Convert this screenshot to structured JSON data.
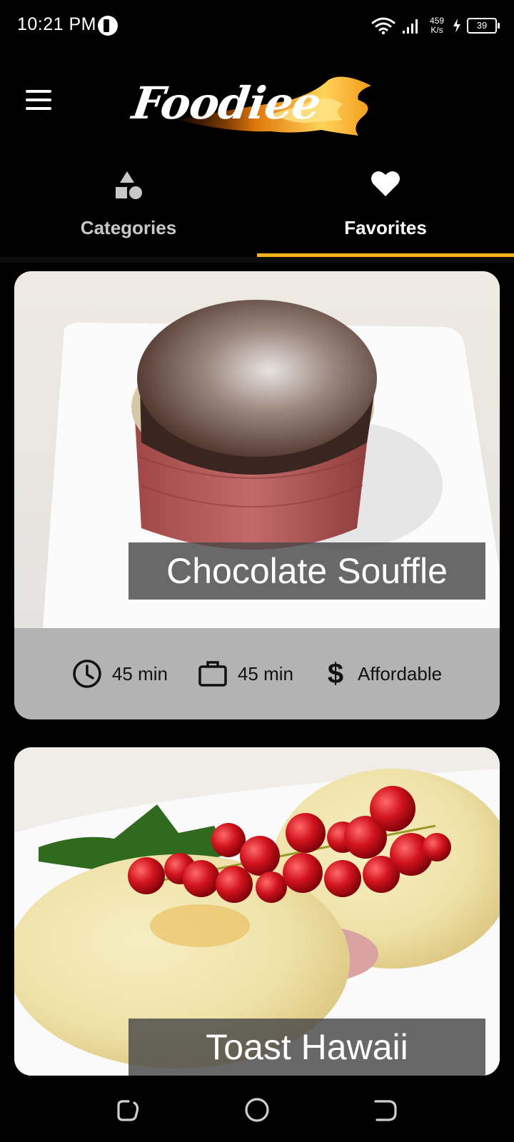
{
  "status_bar": {
    "time": "10:21 PM",
    "net_speed_value": "459",
    "net_speed_unit": "K/s",
    "battery": "39"
  },
  "app": {
    "logo_text": "Foodiee"
  },
  "tabs": [
    {
      "label": "Categories",
      "icon": "shapes-icon",
      "active": false
    },
    {
      "label": "Favorites",
      "icon": "heart-icon",
      "active": true
    }
  ],
  "accent_color": "#f6b418",
  "meals": [
    {
      "title": "Chocolate Souffle",
      "duration": "45 min",
      "complexity": "45 min",
      "affordability": "Affordable"
    },
    {
      "title": "Toast Hawaii"
    }
  ]
}
